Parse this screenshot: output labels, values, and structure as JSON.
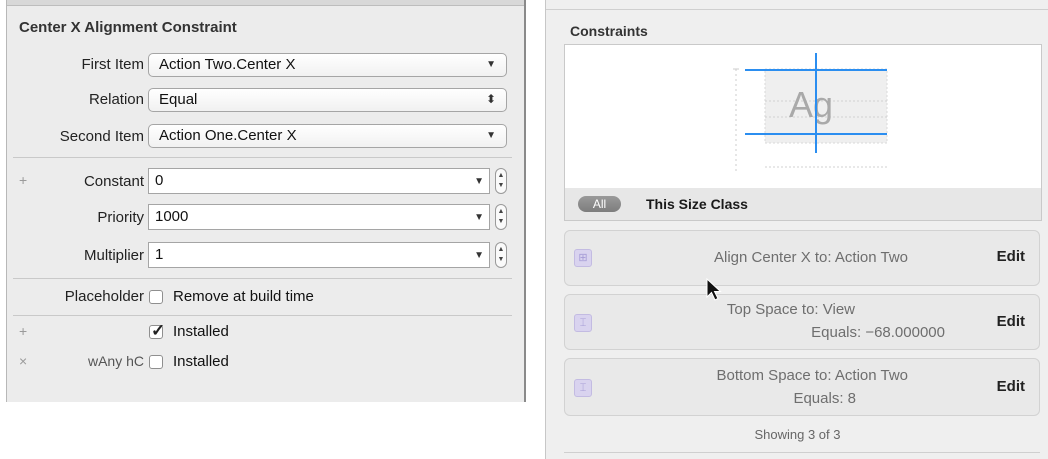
{
  "inspector": {
    "title": "Center X Alignment Constraint",
    "first_item": {
      "label": "First Item",
      "value": "Action Two.Center X"
    },
    "relation": {
      "label": "Relation",
      "value": "Equal"
    },
    "second_item": {
      "label": "Second Item",
      "value": "Action One.Center X"
    },
    "constant": {
      "label": "Constant",
      "value": "0"
    },
    "priority": {
      "label": "Priority",
      "value": "1000"
    },
    "multiplier": {
      "label": "Multiplier",
      "value": "1"
    },
    "placeholder": {
      "label": "Placeholder",
      "option": "Remove at build time",
      "checked": false
    },
    "installed_rows": [
      {
        "prefix_glyph": "+",
        "size_class": "",
        "label": "Installed",
        "checked": true
      },
      {
        "prefix_glyph": "×",
        "size_class": "wAny hC",
        "label": "Installed",
        "checked": false
      }
    ],
    "add_glyph": "+"
  },
  "constraints_panel": {
    "title": "Constraints",
    "preview_text": "Ag",
    "filter_all": "All",
    "filter_size_class": "This Size Class",
    "rows": [
      {
        "line1": "Align Center X to: Action Two",
        "line2": "",
        "edit": "Edit",
        "icon": "center-x-constraint-icon"
      },
      {
        "line1": "Top Space to: View",
        "line2": "Equals:  −68.000000",
        "edit": "Edit",
        "icon": "vertical-space-constraint-icon"
      },
      {
        "line1": "Bottom Space to: Action Two",
        "line2": "Equals:  8",
        "edit": "Edit",
        "icon": "vertical-space-constraint-icon"
      }
    ],
    "showing": "Showing 3 of 3"
  },
  "colors": {
    "accent_blue": "#2b8ef0",
    "icon_purple": "#d9d3ef"
  }
}
